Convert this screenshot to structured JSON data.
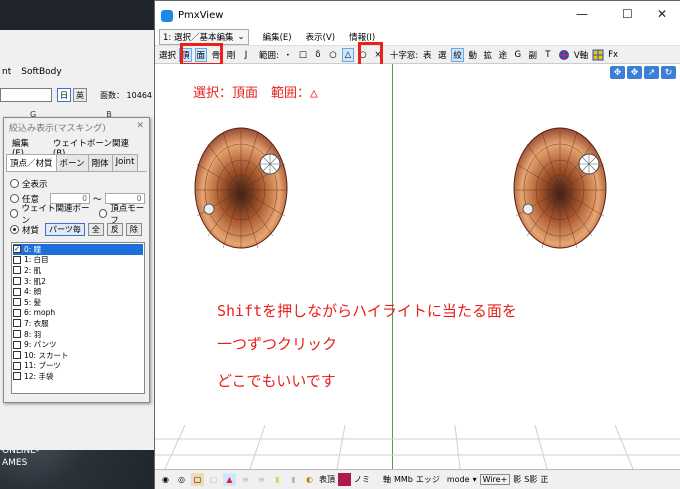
{
  "desktop": {
    "icons": [
      "ONLINE-",
      "AMES"
    ]
  },
  "back_window": {
    "menu": [
      "nt",
      "SoftBody"
    ],
    "buttons": [
      "日",
      "英"
    ],
    "face_count_label": "面数：",
    "face_count": "10464",
    "col_labels": [
      "G",
      "B"
    ]
  },
  "filter_panel": {
    "title": "絞込み表示(マスキング)",
    "menu": [
      "編集(E)",
      "ウェイトボーン関連(B)"
    ],
    "tabs": [
      "頂点／材質",
      "ボーン",
      "剛体",
      "Joint"
    ],
    "options": {
      "show_all": "全表示",
      "any": "任意",
      "any_from": "0",
      "tilde": "〜",
      "any_to": "0",
      "weight_bone": "ウェイト関連ボーン",
      "vertex_morph": "頂点モーフ",
      "material": "材質",
      "per_part": "パーツ毎",
      "all": "全",
      "invert": "反",
      "remove": "除"
    },
    "materials": [
      {
        "label": "0: 瞳",
        "checked": true,
        "selected": true
      },
      {
        "label": "1: 白目",
        "checked": false,
        "selected": false
      },
      {
        "label": "2: 肌",
        "checked": false,
        "selected": false
      },
      {
        "label": "3: 肌2",
        "checked": false,
        "selected": false
      },
      {
        "label": "4: 顔",
        "checked": false,
        "selected": false
      },
      {
        "label": "5: 髪",
        "checked": false,
        "selected": false
      },
      {
        "label": "6: moph",
        "checked": false,
        "selected": false
      },
      {
        "label": "7: 衣服",
        "checked": false,
        "selected": false
      },
      {
        "label": "8: 羽",
        "checked": false,
        "selected": false
      },
      {
        "label": "9: パンツ",
        "checked": false,
        "selected": false
      },
      {
        "label": "10: スカート",
        "checked": false,
        "selected": false
      },
      {
        "label": "11: ブーツ",
        "checked": false,
        "selected": false
      },
      {
        "label": "12: 手袋",
        "checked": false,
        "selected": false
      }
    ]
  },
  "pmxview": {
    "title": "PmxView",
    "controls": {
      "minimize": "—",
      "maximize": "☐",
      "close": "✕"
    },
    "mode_dropdown": "1: 選択／基本編集",
    "menu": [
      "編集(E)",
      "表示(V)",
      "情報(I)"
    ],
    "toolbar": {
      "select_label": "選択",
      "vertex": "頂",
      "face": "面",
      "bone": "骨",
      "body": "剛",
      "joint": "J",
      "range_label": "範囲:",
      "range_point": "・",
      "range_rect": "□",
      "range_lasso": "δ",
      "range_circle": "○",
      "range_triangle": "△",
      "range_o": "○",
      "range_x": "×",
      "cross_label": "十字窓:",
      "b1": "表",
      "b2": "選",
      "b3": "絞",
      "b4": "動",
      "b5": "拡",
      "b6": "途",
      "b7": "G",
      "b8": "副",
      "b9": "T",
      "vaxis": "V軸",
      "fx": "Fx"
    },
    "annotations": {
      "top": "選択：頂面　範囲：△",
      "line1": "Shiftを押しながらハイライトに当たる面を",
      "line2": "一つずつクリック",
      "line3": "どこでもいいです"
    },
    "statusbar": {
      "hyouchou": "表頂",
      "nogi": "ノミ",
      "jiku": "軸",
      "mb": "MMb",
      "edge": "エッジ",
      "mode": "mode",
      "wire": "Wire+",
      "shadow": "影",
      "s_shadow": "S影",
      "sei": "正"
    }
  }
}
